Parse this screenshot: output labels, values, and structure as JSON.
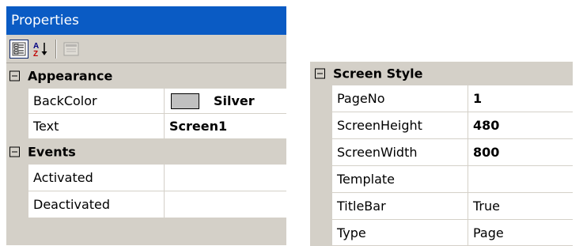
{
  "left_panel": {
    "title": "Properties",
    "toolbar": {
      "categorized_icon": "categorized-view-icon",
      "alphabetical_icon": "sort-az-icon",
      "alphabetical_text": "A Z",
      "pages_icon": "property-pages-icon"
    },
    "categories": [
      {
        "label": "Appearance",
        "toggle": "⊟",
        "properties": [
          {
            "name": "BackColor",
            "value": "Silver",
            "swatch_color": "#c0c0c0",
            "bold": true
          },
          {
            "name": "Text",
            "value": "Screen1",
            "bold": true
          }
        ]
      },
      {
        "label": "Events",
        "toggle": "⊟",
        "properties": [
          {
            "name": "Activated",
            "value": ""
          },
          {
            "name": "Deactivated",
            "value": ""
          }
        ]
      }
    ]
  },
  "right_panel": {
    "category": {
      "label": "Screen Style",
      "toggle": "⊟"
    },
    "properties": [
      {
        "name": "PageNo",
        "value": "1",
        "bold": true
      },
      {
        "name": "ScreenHeight",
        "value": "480",
        "bold": true
      },
      {
        "name": "ScreenWidth",
        "value": "800",
        "bold": true
      },
      {
        "name": "Template",
        "value": ""
      },
      {
        "name": "TitleBar",
        "value": "True",
        "bold": false
      },
      {
        "name": "Type",
        "value": "Page",
        "bold": false
      }
    ]
  },
  "colors": {
    "title_bar": "#0a5bc4",
    "panel_gray": "#d4d0c8",
    "cell_white": "#ffffff",
    "silver": "#c0c0c0"
  }
}
